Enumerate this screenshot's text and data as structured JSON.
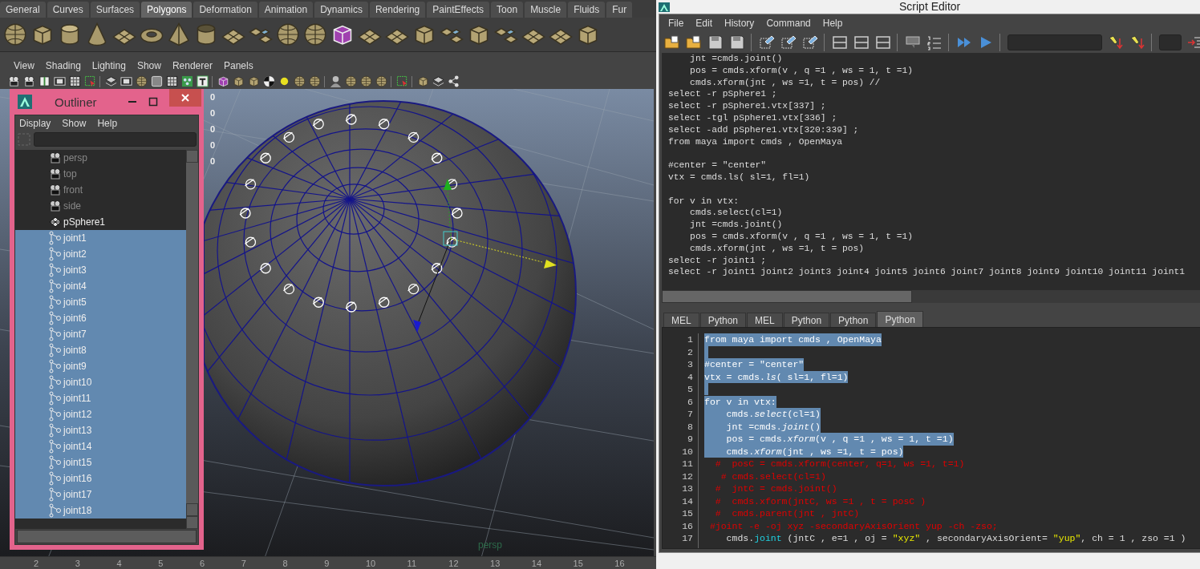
{
  "shelf": {
    "tabs": [
      {
        "label": "General",
        "selected": false
      },
      {
        "label": "Curves",
        "selected": false
      },
      {
        "label": "Surfaces",
        "selected": false
      },
      {
        "label": "Polygons",
        "selected": true
      },
      {
        "label": "Deformation",
        "selected": false
      },
      {
        "label": "Animation",
        "selected": false
      },
      {
        "label": "Dynamics",
        "selected": false
      },
      {
        "label": "Rendering",
        "selected": false
      },
      {
        "label": "PaintEffects",
        "selected": false
      },
      {
        "label": "Toon",
        "selected": false
      },
      {
        "label": "Muscle",
        "selected": false
      },
      {
        "label": "Fluids",
        "selected": false
      },
      {
        "label": "Fur",
        "selected": false
      }
    ]
  },
  "panel": {
    "menu": [
      "View",
      "Shading",
      "Lighting",
      "Show",
      "Renderer",
      "Panels"
    ]
  },
  "viewport": {
    "hud_values": [
      "0",
      "0",
      "0",
      "0",
      "0"
    ],
    "camera_label": "persp"
  },
  "time_ruler": {
    "ticks": [
      "2",
      "3",
      "4",
      "5",
      "6",
      "7",
      "8",
      "9",
      "10",
      "11",
      "12",
      "13",
      "14",
      "15",
      "16"
    ]
  },
  "outliner": {
    "title": "Outliner",
    "menu": [
      "Display",
      "Show",
      "Help"
    ],
    "items": [
      {
        "label": "persp",
        "kind": "camera",
        "dimmed": true,
        "selected": false
      },
      {
        "label": "top",
        "kind": "camera",
        "dimmed": true,
        "selected": false
      },
      {
        "label": "front",
        "kind": "camera",
        "dimmed": true,
        "selected": false
      },
      {
        "label": "side",
        "kind": "camera",
        "dimmed": true,
        "selected": false
      },
      {
        "label": "pSphere1",
        "kind": "mesh",
        "dimmed": false,
        "selected": false
      },
      {
        "label": "joint1",
        "kind": "joint",
        "dimmed": false,
        "selected": true
      },
      {
        "label": "joint2",
        "kind": "joint",
        "dimmed": false,
        "selected": true
      },
      {
        "label": "joint3",
        "kind": "joint",
        "dimmed": false,
        "selected": true
      },
      {
        "label": "joint4",
        "kind": "joint",
        "dimmed": false,
        "selected": true
      },
      {
        "label": "joint5",
        "kind": "joint",
        "dimmed": false,
        "selected": true
      },
      {
        "label": "joint6",
        "kind": "joint",
        "dimmed": false,
        "selected": true
      },
      {
        "label": "joint7",
        "kind": "joint",
        "dimmed": false,
        "selected": true
      },
      {
        "label": "joint8",
        "kind": "joint",
        "dimmed": false,
        "selected": true
      },
      {
        "label": "joint9",
        "kind": "joint",
        "dimmed": false,
        "selected": true
      },
      {
        "label": "joint10",
        "kind": "joint",
        "dimmed": false,
        "selected": true
      },
      {
        "label": "joint11",
        "kind": "joint",
        "dimmed": false,
        "selected": true
      },
      {
        "label": "joint12",
        "kind": "joint",
        "dimmed": false,
        "selected": true
      },
      {
        "label": "joint13",
        "kind": "joint",
        "dimmed": false,
        "selected": true
      },
      {
        "label": "joint14",
        "kind": "joint",
        "dimmed": false,
        "selected": true
      },
      {
        "label": "joint15",
        "kind": "joint",
        "dimmed": false,
        "selected": true
      },
      {
        "label": "joint16",
        "kind": "joint",
        "dimmed": false,
        "selected": true
      },
      {
        "label": "joint17",
        "kind": "joint",
        "dimmed": false,
        "selected": true
      },
      {
        "label": "joint18",
        "kind": "joint",
        "dimmed": false,
        "selected": true
      }
    ]
  },
  "script_editor": {
    "title": "Script Editor",
    "menu": [
      "File",
      "Edit",
      "History",
      "Command",
      "Help"
    ],
    "history": {
      "blocks": [
        [
          "    jnt =cmds.joint()",
          "    pos = cmds.xform(v , q =1 , ws = 1, t =1)",
          "    cmds.xform(jnt , ws =1, t = pos) //",
          "select -r pSphere1 ;",
          "select -r pSphere1.vtx[337] ;",
          "select -tgl pSphere1.vtx[336] ;",
          "select -add pSphere1.vtx[320:339] ;",
          "from maya import cmds , OpenMaya"
        ],
        [
          "#center = \"center\"",
          "vtx = cmds.ls( sl=1, fl=1)"
        ],
        [
          "for v in vtx:",
          "    cmds.select(cl=1)",
          "    jnt =cmds.joint()",
          "    pos = cmds.xform(v , q =1 , ws = 1, t =1)",
          "    cmds.xform(jnt , ws =1, t = pos)",
          "select -r joint1 ;",
          "select -r joint1 joint2 joint3 joint4 joint5 joint6 joint7 joint8 joint9 joint10 joint11 joint1"
        ]
      ]
    },
    "tabs": [
      {
        "label": "MEL",
        "selected": false
      },
      {
        "label": "Python",
        "selected": false
      },
      {
        "label": "MEL",
        "selected": false
      },
      {
        "label": "Python",
        "selected": false
      },
      {
        "label": "Python",
        "selected": false
      },
      {
        "label": "Python",
        "selected": true
      }
    ],
    "lines": [
      {
        "number": "1",
        "selected": true,
        "parts": [
          {
            "kind": "plain",
            "text": "from maya import cmds , OpenMaya"
          }
        ]
      },
      {
        "number": "2",
        "selected": true
      },
      {
        "number": "3",
        "selected": true,
        "parts": [
          {
            "kind": "plain",
            "text": "#center = \"center\""
          }
        ]
      },
      {
        "number": "4",
        "selected": true,
        "parts": [
          {
            "kind": "plain",
            "text": "vtx = cmds.*ls*( sl=1, fl=1)"
          }
        ]
      },
      {
        "number": "5",
        "selected": true
      },
      {
        "number": "6",
        "selected": true,
        "parts": [
          {
            "kind": "plain",
            "text": "for v in vtx:"
          }
        ]
      },
      {
        "number": "7",
        "selected": true,
        "parts": [
          {
            "kind": "plain",
            "text": "    cmds.*select*(cl=1)"
          }
        ]
      },
      {
        "number": "8",
        "selected": true,
        "parts": [
          {
            "kind": "plain",
            "text": "    jnt =cmds.*joint*()"
          }
        ]
      },
      {
        "number": "9",
        "selected": true,
        "parts": [
          {
            "kind": "plain",
            "text": "    pos = cmds.*xform*(v , q =1 , ws = 1, t =1)"
          }
        ]
      },
      {
        "number": "10",
        "selected": true,
        "parts": [
          {
            "kind": "plain",
            "text": "    cmds.*xform*(jnt , ws =1, t = pos)"
          }
        ]
      },
      {
        "number": "11",
        "selected": false,
        "parts": [
          {
            "kind": "comment",
            "text": "  #  posC = cmds.xform(center, q=1, ws =1, t=1)"
          }
        ]
      },
      {
        "number": "12",
        "selected": false,
        "parts": [
          {
            "kind": "comment",
            "text": "   # cmds.select(cl=1)"
          }
        ]
      },
      {
        "number": "13",
        "selected": false,
        "parts": [
          {
            "kind": "comment",
            "text": "  #  jntC = cmds.joint()"
          }
        ]
      },
      {
        "number": "14",
        "selected": false,
        "parts": [
          {
            "kind": "comment",
            "text": "  #  cmds.xform(jntC, ws =1 , t = posC )"
          }
        ]
      },
      {
        "number": "15",
        "selected": false,
        "parts": [
          {
            "kind": "comment",
            "text": "  #  cmds.parent(jnt , jntC)"
          }
        ]
      },
      {
        "number": "16",
        "selected": false,
        "parts": [
          {
            "kind": "comment",
            "text": " #joint -e -oj xyz -secondaryAxisOrient yup -ch -zso;"
          }
        ]
      },
      {
        "number": "17",
        "selected": false,
        "parts": [
          {
            "kind": "plain",
            "text": "    cmds."
          },
          {
            "kind": "function",
            "text": "joint"
          },
          {
            "kind": "plain",
            "text": " (jntC , e=1 , oj = "
          },
          {
            "kind": "string",
            "text": "\"xyz\""
          },
          {
            "kind": "plain",
            "text": " , secondaryAxisOrient= "
          },
          {
            "kind": "string",
            "text": "\"yup\""
          },
          {
            "kind": "plain",
            "text": ", ch = 1 , zso =1 )"
          }
        ]
      }
    ]
  }
}
